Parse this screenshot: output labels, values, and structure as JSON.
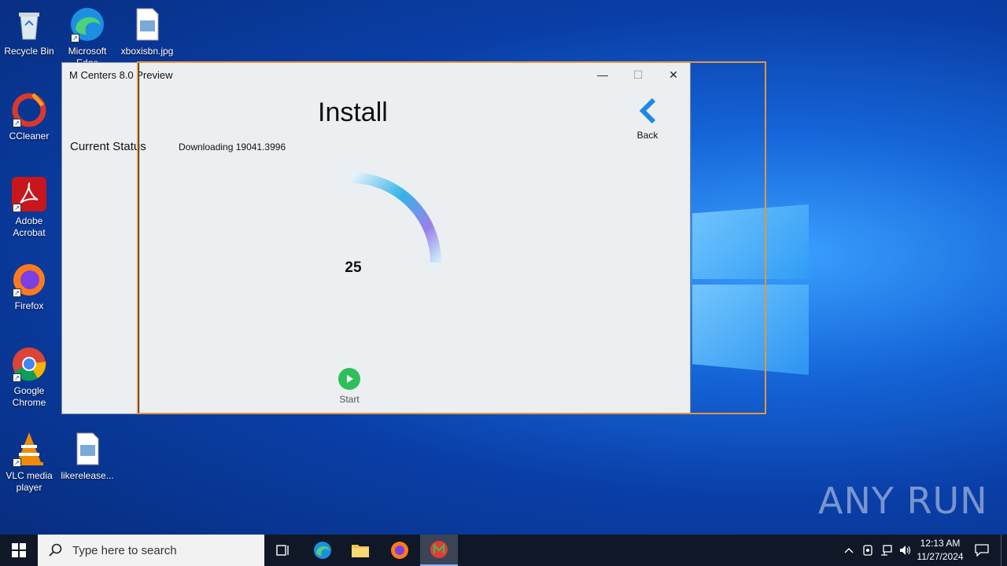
{
  "desktop": {
    "icons": [
      {
        "label": "Recycle Bin"
      },
      {
        "label": "Microsoft Edge"
      },
      {
        "label": "xboxisbn.jpg"
      },
      {
        "label": "CCleaner"
      },
      {
        "label": "Adobe Acrobat"
      },
      {
        "label": "Firefox"
      },
      {
        "label": "Google Chrome"
      },
      {
        "label": "VLC media player"
      },
      {
        "label": "likerelease..."
      }
    ],
    "watermark": "ANY RUN"
  },
  "window": {
    "title": "M Centers 8.0 Preview",
    "minimize": "—",
    "maximize": "☐",
    "close": "✕",
    "page_title": "Install",
    "back_label": "Back",
    "status_label": "Current Status",
    "status_value": "Downloading 19041.3996",
    "progress_value": "25",
    "start_label": "Start"
  },
  "taskbar": {
    "search_placeholder": "Type here to search",
    "time": "12:13 AM",
    "date": "11/27/2024"
  }
}
